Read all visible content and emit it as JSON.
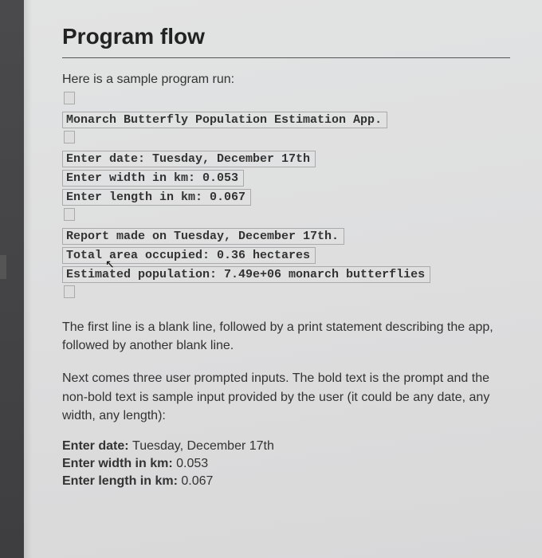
{
  "section_title": "Program flow",
  "intro": "Here is a sample program run:",
  "run": {
    "title_line": "Monarch Butterfly Population Estimation App.",
    "input_lines": [
      "Enter date: Tuesday, December 17th",
      "Enter width in km: 0.053",
      "Enter length in km: 0.067"
    ],
    "output_lines": [
      "Report made on Tuesday, December 17th.",
      "Total area occupied: 0.36 hectares",
      "Estimated population: 7.49e+06 monarch butterflies"
    ]
  },
  "paragraphs": {
    "p1": "The first line is a blank line, followed by a print statement describing the app, followed by another blank line.",
    "p2": "Next comes three user prompted inputs. The bold text is the prompt and the non-bold text is sample input provided by the user (it could be any date, any width, any length):"
  },
  "examples": [
    {
      "prompt": "Enter date: ",
      "value": "Tuesday, December 17th"
    },
    {
      "prompt": "Enter width in km: ",
      "value": "0.053"
    },
    {
      "prompt": "Enter length in km: ",
      "value": "0.067"
    }
  ]
}
